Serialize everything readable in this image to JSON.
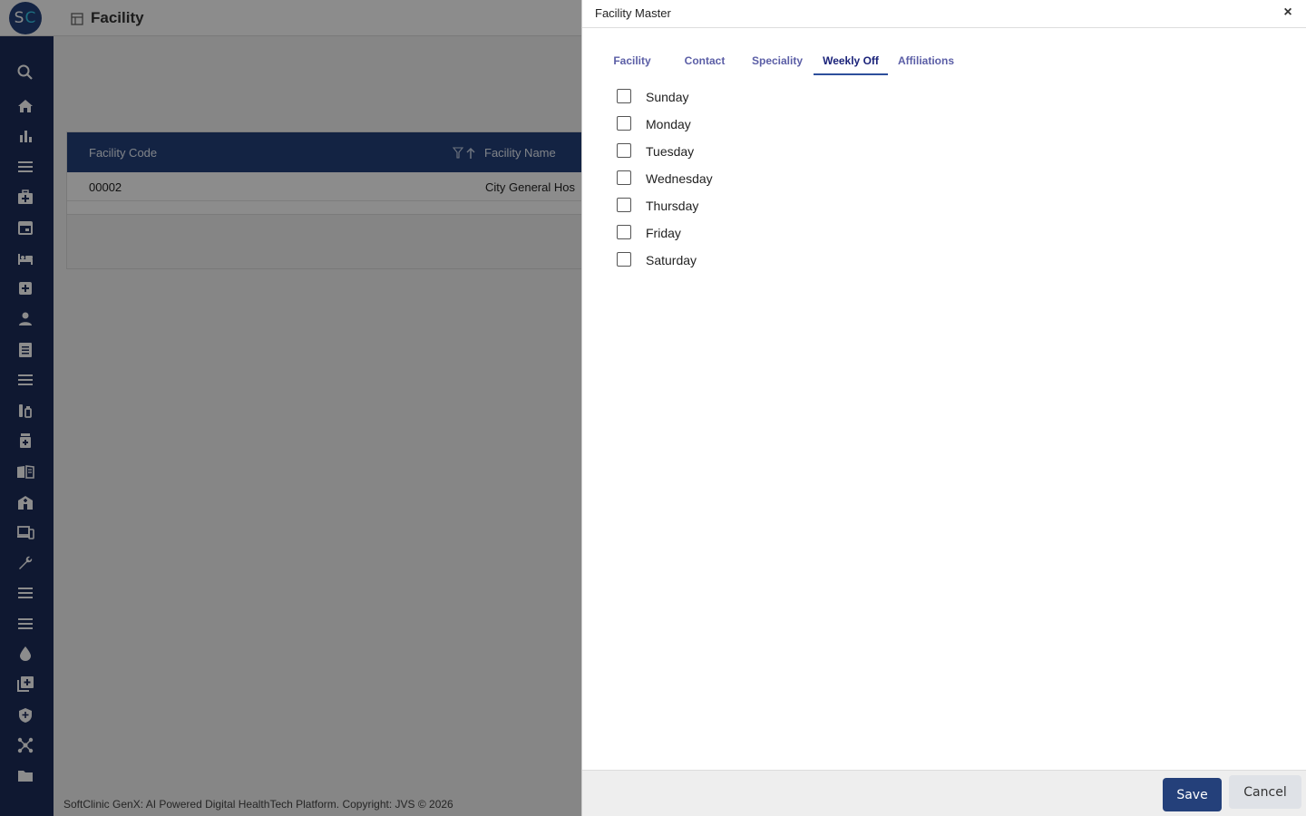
{
  "app": {
    "logo_s": "S",
    "logo_c": "C",
    "page_title": "Facility",
    "footer": "SoftClinic GenX: AI Powered Digital HealthTech Platform. Copyright: JVS © 2026"
  },
  "sidebar": {
    "icons": [
      "search-icon",
      "home-icon",
      "bar-chart-icon",
      "menu-icon",
      "medical-bag-icon",
      "calendar-icon",
      "bed-icon",
      "medical-plus-icon",
      "person-icon",
      "document-list-icon",
      "list-icon",
      "vials-icon",
      "pill-bottle-icon",
      "book-icon",
      "hospital-building-icon",
      "devices-icon",
      "wrench-icon",
      "list-icon-2",
      "list-icon-3",
      "water-drop-icon",
      "add-library-icon",
      "shield-icon",
      "network-icon",
      "folder-icon"
    ]
  },
  "grid": {
    "columns": [
      "Facility Code",
      "Facility Name"
    ],
    "rows": [
      {
        "code": "00002",
        "name": "City General Hos"
      }
    ]
  },
  "dialog": {
    "title": "Facility Master",
    "close_symbol": "×",
    "tabs": [
      {
        "label": "Facility",
        "active": false
      },
      {
        "label": "Contact",
        "active": false
      },
      {
        "label": "Speciality",
        "active": false
      },
      {
        "label": "Weekly Off",
        "active": true
      },
      {
        "label": "Affiliations",
        "active": false
      }
    ],
    "days": [
      {
        "label": "Sunday",
        "checked": false
      },
      {
        "label": "Monday",
        "checked": false
      },
      {
        "label": "Tuesday",
        "checked": false
      },
      {
        "label": "Wednesday",
        "checked": false
      },
      {
        "label": "Thursday",
        "checked": false
      },
      {
        "label": "Friday",
        "checked": false
      },
      {
        "label": "Saturday",
        "checked": false
      }
    ],
    "save_label": "Save",
    "cancel_label": "Cancel"
  },
  "colors": {
    "sidebar": "#1d2c5a",
    "primary": "#24407a",
    "tab_active": "#1b237a",
    "tab": "#5b5ea6"
  }
}
